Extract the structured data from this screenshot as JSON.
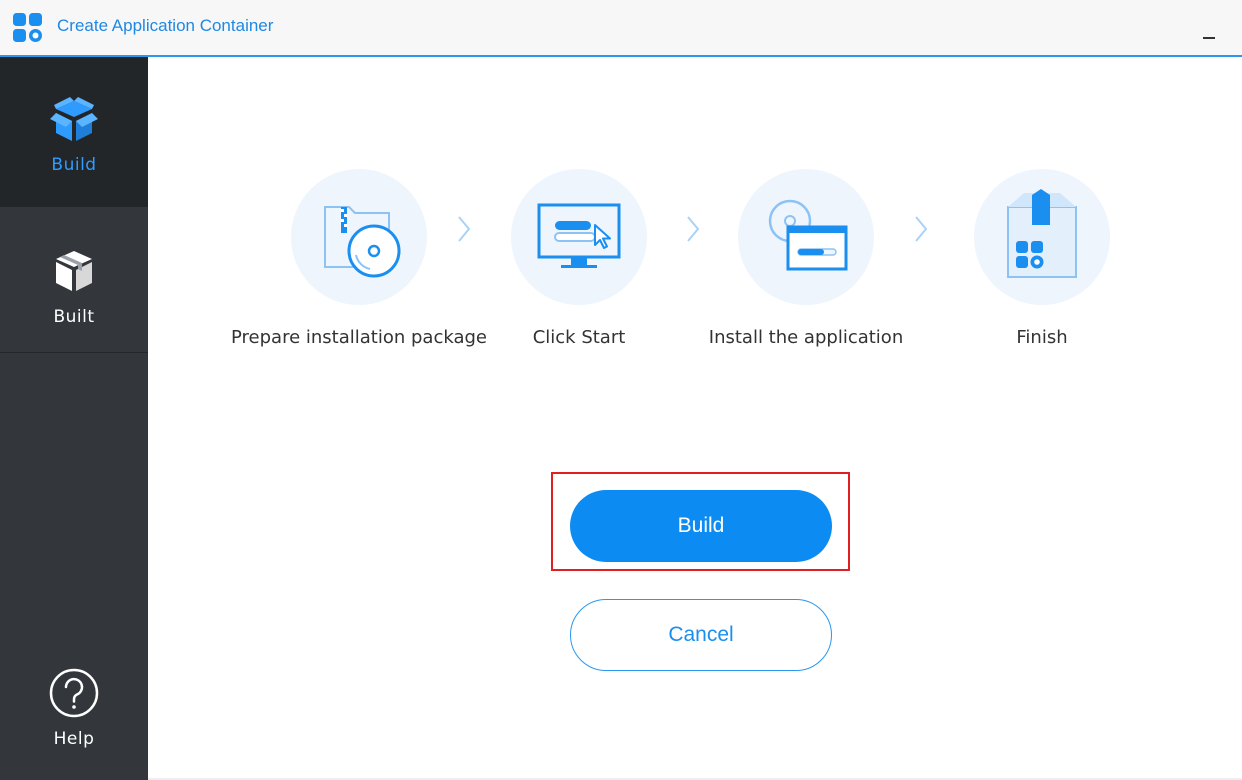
{
  "window": {
    "title": "Create Application Container",
    "logo_icon": "app-container-logo-icon",
    "minimize_icon": "minimize-icon"
  },
  "sidebar": {
    "items": [
      {
        "label": "Build",
        "icon": "box-open-icon",
        "active": true
      },
      {
        "label": "Built",
        "icon": "box-closed-icon",
        "active": false
      },
      {
        "label": "Help",
        "icon": "question-circle-icon",
        "active": false
      }
    ]
  },
  "steps": [
    {
      "label": "Prepare installation package",
      "icon": "package-disc-icon"
    },
    {
      "label": "Click Start",
      "icon": "monitor-click-icon"
    },
    {
      "label": "Install the application",
      "icon": "install-window-icon"
    },
    {
      "label": "Finish",
      "icon": "finished-box-icon"
    }
  ],
  "actions": {
    "build_label": "Build",
    "cancel_label": "Cancel"
  },
  "colors": {
    "accent": "#0c8cf2",
    "sidebar_bg": "#33373c",
    "sidebar_active_bg": "#232629",
    "highlight": "#e02020",
    "step_circle_bg": "#eef5fd"
  }
}
